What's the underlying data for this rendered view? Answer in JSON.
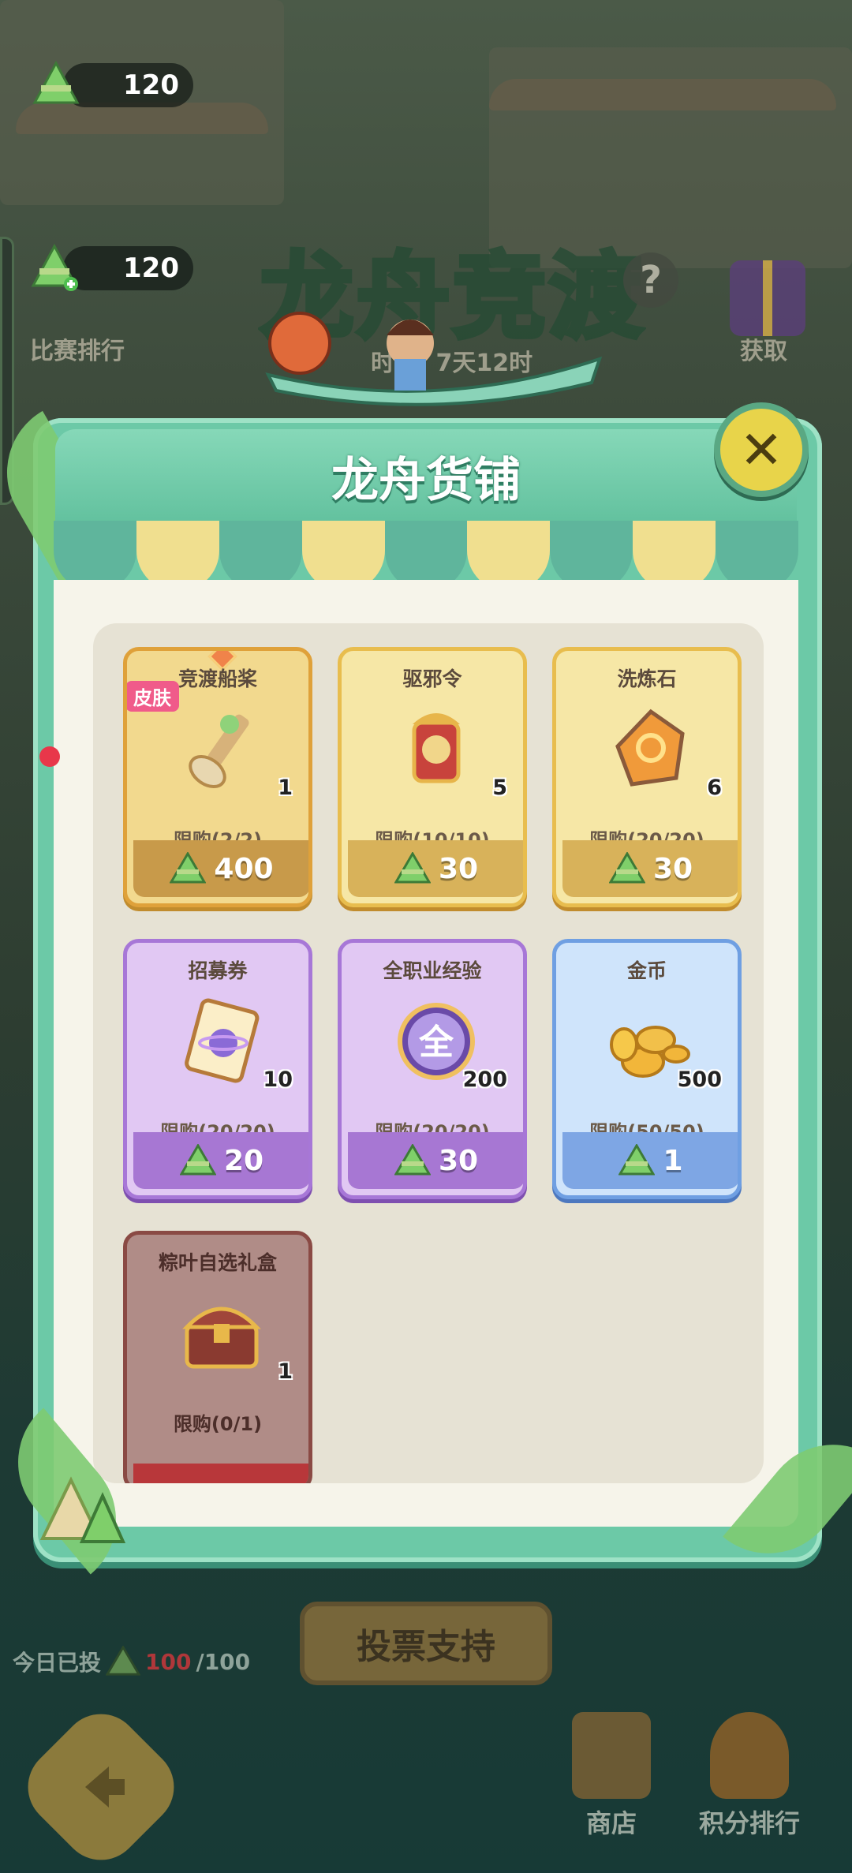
{
  "header": {
    "currency_top": "120",
    "currency_main": "120",
    "rank_label": "比赛排行",
    "event_title": "龙舟竞渡",
    "countdown": "时间: 7天12时",
    "help": "?",
    "gift_label": "获取"
  },
  "shop": {
    "title": "龙舟货铺",
    "close": "✕",
    "items": [
      {
        "name": "竞渡船桨",
        "tag": "皮肤",
        "qty": "1",
        "limit": "限购(2/2)",
        "price": "400",
        "style": "gold",
        "icon": "paddle-icon"
      },
      {
        "name": "驱邪令",
        "qty": "5",
        "limit": "限购(10/10)",
        "price": "30",
        "style": "gold",
        "icon": "token-icon"
      },
      {
        "name": "洗炼石",
        "qty": "6",
        "limit": "限购(20/20)",
        "price": "30",
        "style": "gold",
        "icon": "stone-icon"
      },
      {
        "name": "招募券",
        "qty": "10",
        "limit": "限购(20/20)",
        "price": "20",
        "style": "purple",
        "icon": "ticket-icon"
      },
      {
        "name": "全职业经验",
        "qty": "200",
        "limit": "限购(20/20)",
        "price": "30",
        "style": "purple",
        "icon": "exp-orb-icon",
        "badge": "全"
      },
      {
        "name": "金币",
        "qty": "500",
        "limit": "限购(50/50)",
        "price": "1",
        "style": "blue",
        "icon": "coin-icon"
      },
      {
        "name": "粽叶自选礼盒",
        "qty": "1",
        "limit": "限购(0/1)",
        "price": "",
        "style": "red",
        "icon": "chest-icon"
      }
    ]
  },
  "footer": {
    "vote_label": "投票支持",
    "today_label": "今日已投",
    "today_used": "100",
    "today_total": "/100",
    "shop_label": "商店",
    "points_rank_label": "积分排行"
  },
  "colors": {
    "modal": "#6cc9a7",
    "gold_card": "#f6e7a6",
    "purple_card": "#e1c8f3",
    "blue_card": "#cfe4fb"
  }
}
